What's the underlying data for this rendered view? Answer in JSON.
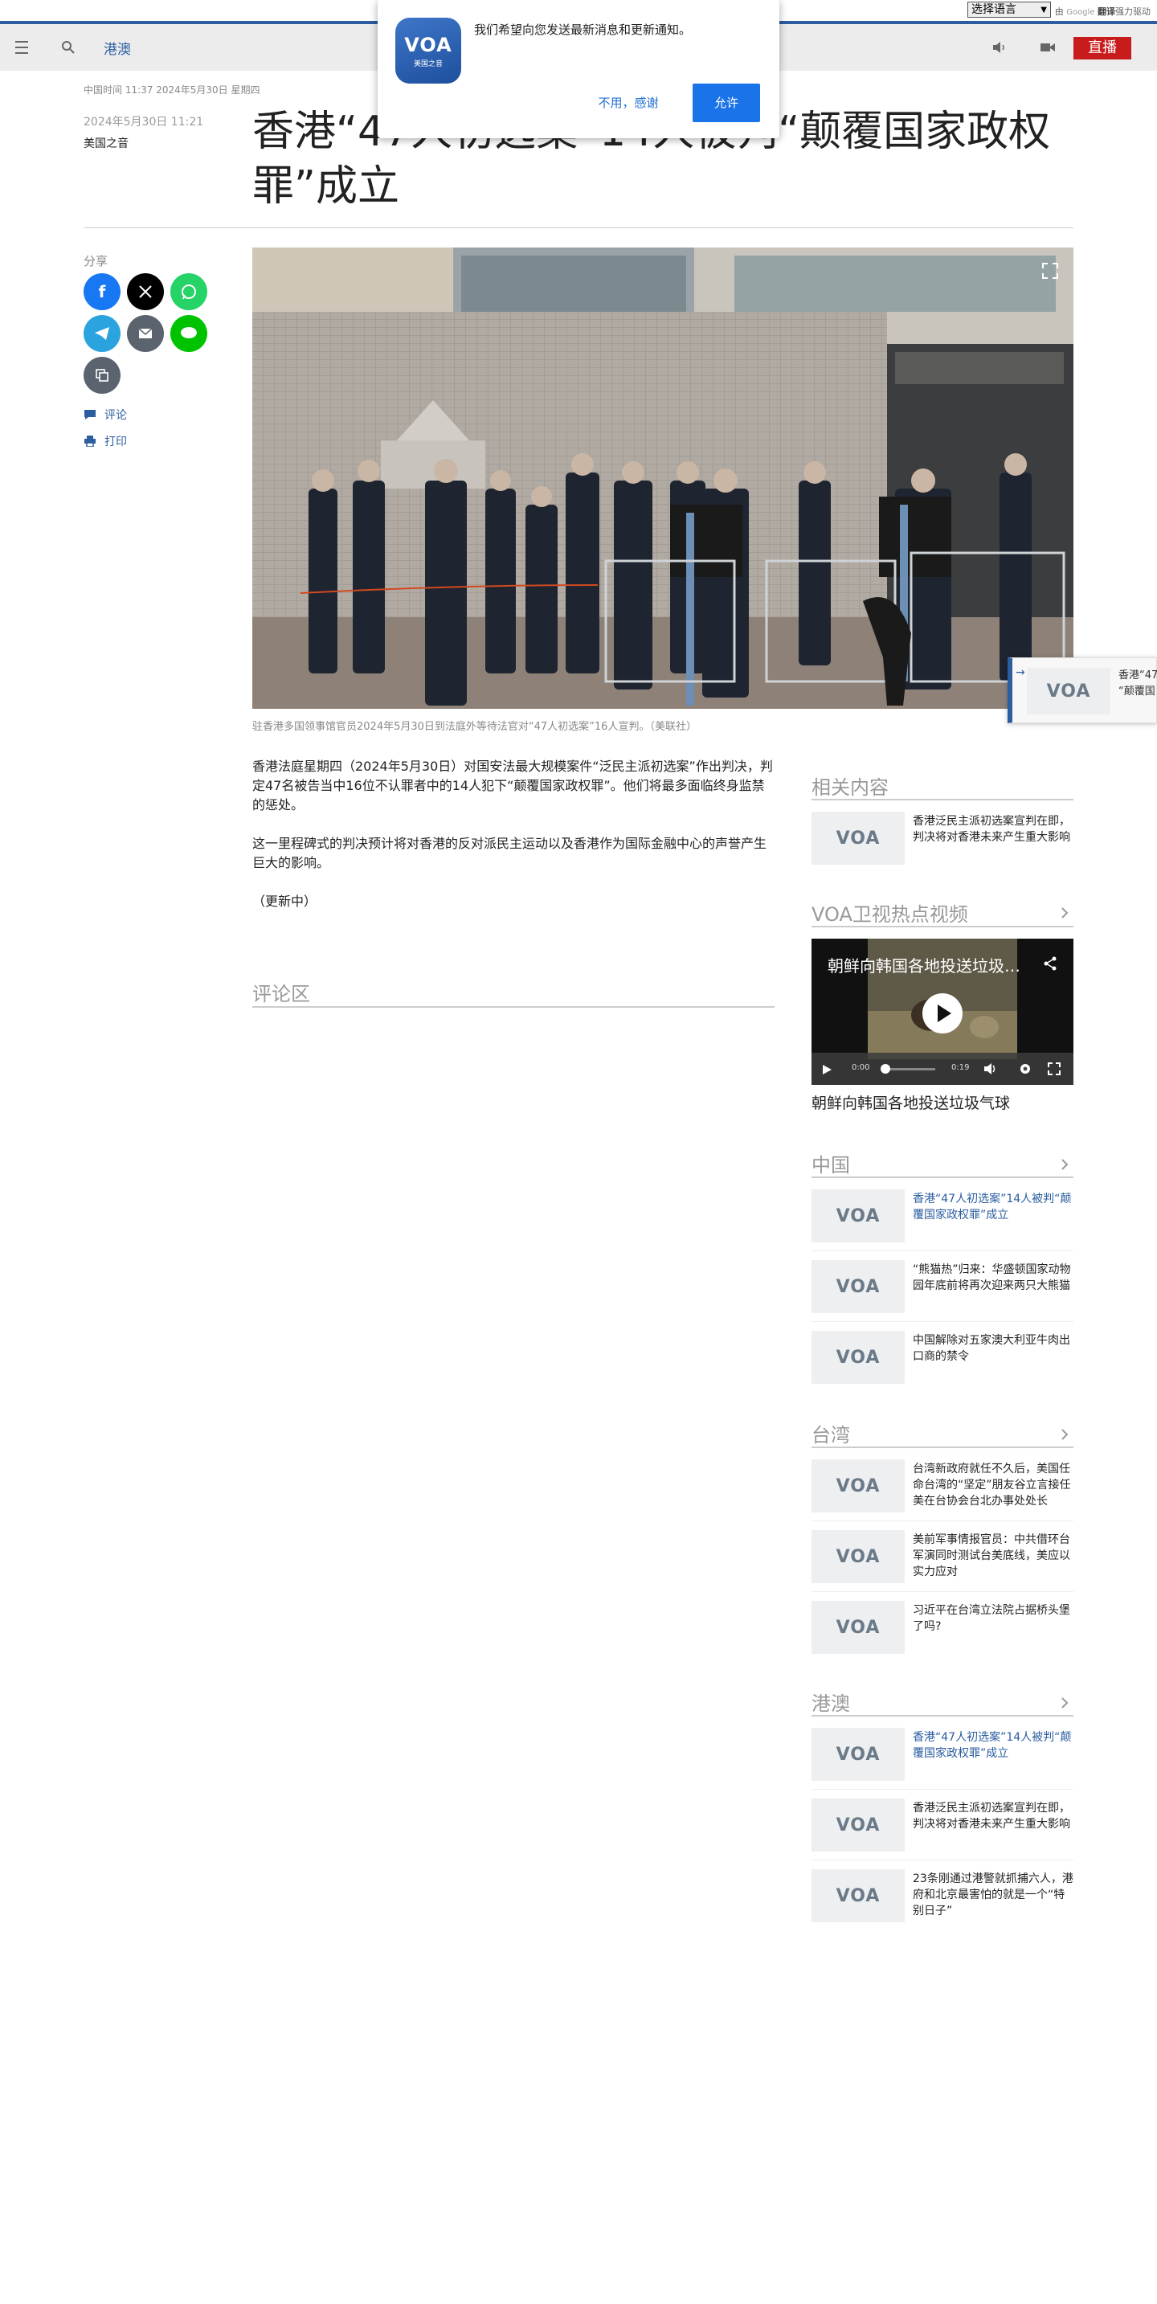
{
  "translate_bar": {
    "select_label": "选择语言",
    "credit_prefix": "由",
    "credit_google": "Google",
    "credit_translate": "翻译",
    "credit_suffix": "强力驱动"
  },
  "header": {
    "section": "港澳",
    "live_label": "直播"
  },
  "notification": {
    "logo_text": "VOA",
    "logo_subtitle": "美国之音",
    "message": "我们希望向您发送最新消息和更新通知。",
    "decline_label": "不用，感谢",
    "allow_label": "允许"
  },
  "article": {
    "timestamp_top": "中国时间 11:37 2024年5月30日 星期四",
    "date": "2024年5月30日 11:21",
    "author": "美国之音",
    "headline": "香港“47人初选案”14人被判“颠覆国家政权罪”成立",
    "caption": "驻香港多国领事馆官员2024年5月30日到法庭外等待法官对“47人初选案”16人宣判。（美联社）",
    "paragraphs": [
      "香港法庭星期四（2024年5月30日）对国安法最大规模案件“泛民主派初选案”作出判决，判定47名被告当中16位不认罪者中的14人犯下“颠覆国家政权罪”。他们将最多面临终身监禁的惩处。",
      "这一里程碑式的判决预计将对香港的反对派民主运动以及香港作为国际金融中心的声誉产生巨大的影响。",
      "（更新中）"
    ],
    "comments_title": "评论区"
  },
  "share": {
    "label": "分享",
    "comment_link": "评论",
    "print_link": "打印"
  },
  "sidebar": {
    "related": {
      "title": "相关内容",
      "items": [
        {
          "text": "香港泛民主派初选案宣判在即，判决将对香港未来产生重大影响"
        }
      ]
    },
    "video": {
      "title": "VOA卫视热点视频",
      "video_title": "朝鲜向韩国各地投送垃圾气球",
      "time_current": "0:00",
      "time_total": "0:19",
      "caption": "朝鲜向韩国各地投送垃圾气球"
    },
    "china": {
      "title": "中国",
      "items": [
        {
          "text": "香港“47人初选案”14人被判“颠覆国家政权罪”成立"
        },
        {
          "text": "“熊猫热”归来：华盛顿国家动物园年底前将再次迎来两只大熊猫"
        },
        {
          "text": "中国解除对五家澳大利亚牛肉出口商的禁令"
        }
      ]
    },
    "taiwan": {
      "title": "台湾",
      "items": [
        {
          "text": "台湾新政府就任不久后，美国任命台湾的“坚定”朋友谷立言接任美在台协会台北办事处处长"
        },
        {
          "text": "美前军事情报官员：中共借环台军演同时测试台美底线，美应以实力应对"
        },
        {
          "text": "习近平在台湾立法院占据桥头堡了吗?"
        }
      ]
    },
    "hkmacau": {
      "title": "港澳",
      "items": [
        {
          "text": "香港“47人初选案”14人被判“颠覆国家政权罪”成立"
        },
        {
          "text": "香港泛民主派初选案宣判在即，判决将对香港未来产生重大影响"
        },
        {
          "text": "23条刚通过港警就抓捕六人，港府和北京最害怕的就是一个“特别日子”"
        }
      ]
    },
    "thumb_logo": "VOA"
  },
  "floating_card": {
    "text_line1": "香港“47",
    "text_line2": "“颠覆国"
  },
  "colors": {
    "accent": "#2b5da0",
    "live_red": "#c81b1b",
    "allow_blue": "#1a73e8"
  }
}
